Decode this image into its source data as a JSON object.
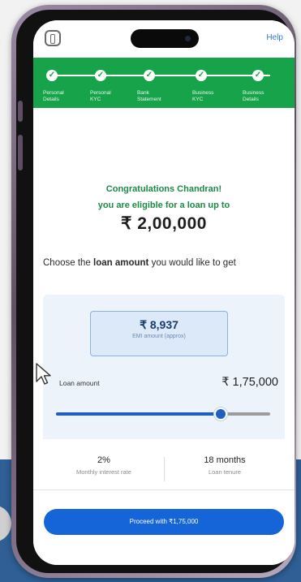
{
  "header": {
    "help_label": "Help"
  },
  "stepper": {
    "steps": [
      {
        "label": "Personal\nDetails"
      },
      {
        "label": "Personal\nKYC"
      },
      {
        "label": "Bank\nStatement"
      },
      {
        "label": "Business\nKYC"
      },
      {
        "label": "Business\nDetails"
      }
    ],
    "completed_glyph": "✓"
  },
  "eligibility": {
    "line1": "Congratulations Chandran!",
    "line2": "you are eligible for a loan up to",
    "amount": "₹ 2,00,000"
  },
  "chooser": {
    "prefix": "Choose the ",
    "bold": "loan amount",
    "suffix": " you would like to get"
  },
  "emi": {
    "value": "₹ 8,937",
    "label": "EMI amount (approx)"
  },
  "loan": {
    "label": "Loan amount",
    "value": "₹ 1,75,000",
    "slider_fraction": 0.76
  },
  "stats": {
    "rate_value": "2%",
    "rate_label": "Monthly interest rate",
    "tenure_value": "18 months",
    "tenure_label": "Loan tenure"
  },
  "cta": {
    "label": "Proceed with ₹1,75,000"
  },
  "icons": {
    "back": "document-back-icon",
    "step": "check-circle-icon",
    "cursor": "mouse-pointer-icon"
  },
  "colors": {
    "brand_green": "#16a34a",
    "primary_blue": "#1565d8",
    "background_blue": "#2f5f95"
  }
}
